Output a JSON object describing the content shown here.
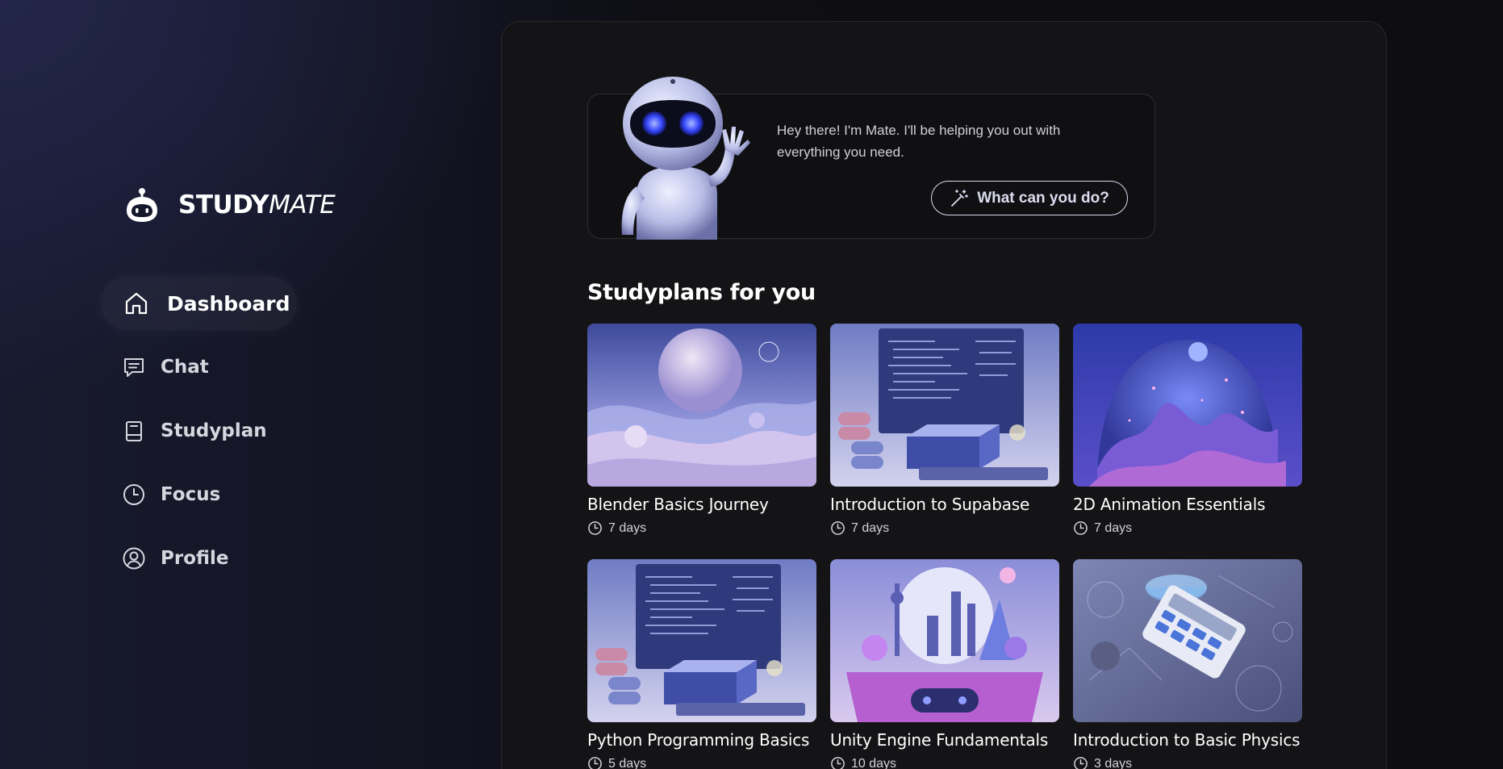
{
  "app": {
    "logo_study": "STUDY",
    "logo_mate": "MATE"
  },
  "sidebar": {
    "items": [
      {
        "label": "Dashboard",
        "icon": "home-icon",
        "active": true
      },
      {
        "label": "Chat",
        "icon": "chat-icon",
        "active": false
      },
      {
        "label": "Studyplan",
        "icon": "book-icon",
        "active": false
      },
      {
        "label": "Focus",
        "icon": "clock-icon",
        "active": false
      },
      {
        "label": "Profile",
        "icon": "user-circle-icon",
        "active": false
      }
    ]
  },
  "mate": {
    "message": "Hey there! I'm Mate. I'll be helping you out with everything you need.",
    "button_label": "What can you do?",
    "button_icon": "magic-wand-icon"
  },
  "studyplans": {
    "heading": "Studyplans for you",
    "items": [
      {
        "title": "Blender Basics Journey",
        "duration": "7 days"
      },
      {
        "title": "Introduction to Supabase",
        "duration": "7 days"
      },
      {
        "title": "2D Animation Essentials",
        "duration": "7 days"
      },
      {
        "title": "Python Programming Basics",
        "duration": "5 days"
      },
      {
        "title": "Unity Engine Fundamentals",
        "duration": "10 days"
      },
      {
        "title": "Introduction to Basic Physics",
        "duration": "3 days"
      }
    ]
  },
  "colors": {
    "accent": "#6f7bf7",
    "background": "#0d0d10",
    "panel": "#141416"
  }
}
